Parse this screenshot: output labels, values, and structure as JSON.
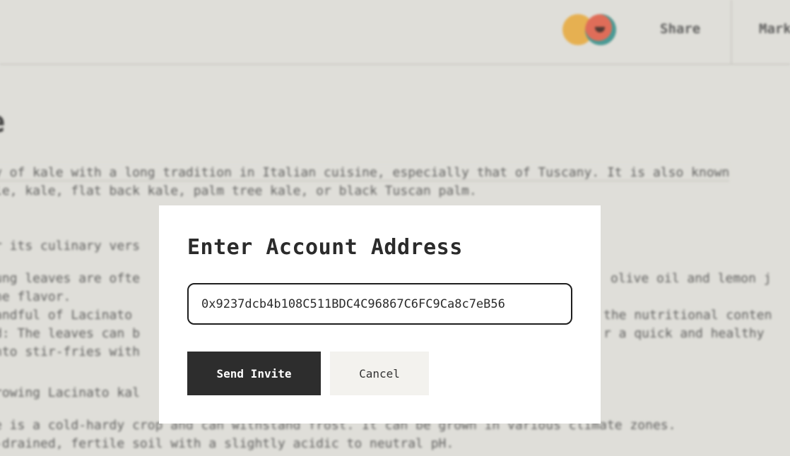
{
  "header": {
    "share_label": "Share",
    "mark_label": "Mark"
  },
  "article": {
    "title": "e",
    "paragraphs": [
      "y of kale with a long tradition in Italian cuisine, especially that of Tuscany. It is also known",
      "le, kale, flat back kale, palm tree kale, or black Tuscan palm.",
      "r its culinary vers",
      "ung leaves are ofte",
      "he flavor.",
      "andful of Lacinato",
      "d: The leaves can b",
      "nto stir-fries with",
      "rowing Lacinato kal",
      "e is a cold-hardy crop and can withstand frost. It can be grown in various climate zones.",
      "-drained, fertile soil with a slightly acidic to neutral pH."
    ],
    "right_fragments": [
      "olive oil and lemon j",
      "the nutritional conten",
      "r a quick and healthy"
    ]
  },
  "modal": {
    "title": "Enter Account Address",
    "address_value": "0x9237dcb4b108C511BDC4C96867C6FC9Ca8c7eB56",
    "send_label": "Send Invite",
    "cancel_label": "Cancel"
  }
}
